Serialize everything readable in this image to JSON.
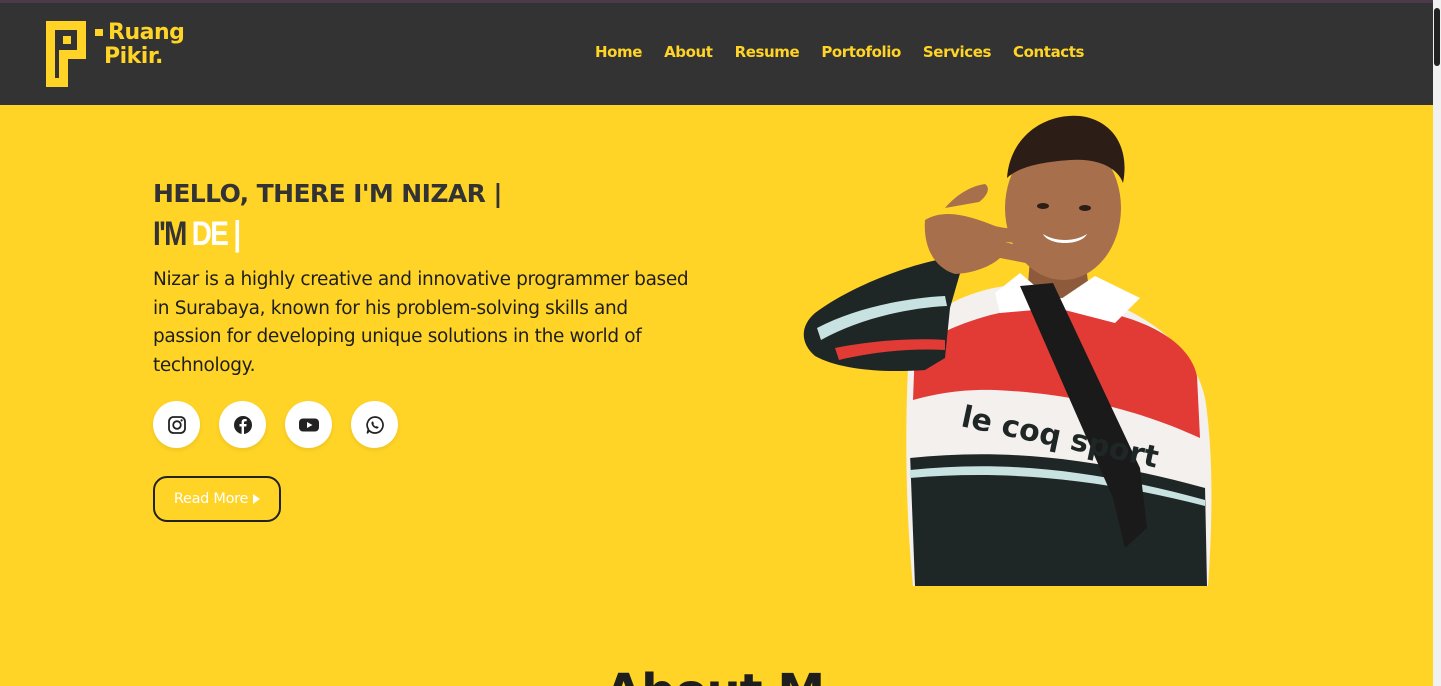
{
  "brand": {
    "name_line1": "Ruang",
    "name_line2": "Pikir."
  },
  "nav": {
    "items": [
      {
        "label": "Home"
      },
      {
        "label": "About"
      },
      {
        "label": "Resume"
      },
      {
        "label": "Portofolio"
      },
      {
        "label": "Services"
      },
      {
        "label": "Contacts"
      }
    ]
  },
  "hero": {
    "greeting": "HELLO, THERE I'M NIZAR |",
    "typed_prefix": "I'M",
    "typed_word": "DE",
    "typed_cursor": "|",
    "bio": "Nizar is a highly creative and innovative programmer based in Surabaya, known for his problem-solving skills and passion for developing unique solutions in the world of technology.",
    "read_more_label": "Read More"
  },
  "socials": [
    {
      "icon": "instagram-icon"
    },
    {
      "icon": "facebook-icon"
    },
    {
      "icon": "youtube-icon"
    },
    {
      "icon": "whatsapp-icon"
    }
  ],
  "photo": {
    "shirt_text": "le coq sport"
  },
  "next_section": {
    "heading": "About M"
  },
  "colors": {
    "accent": "#ffd426",
    "navbar": "#333333",
    "text_dark": "#333333",
    "white": "#ffffff"
  }
}
